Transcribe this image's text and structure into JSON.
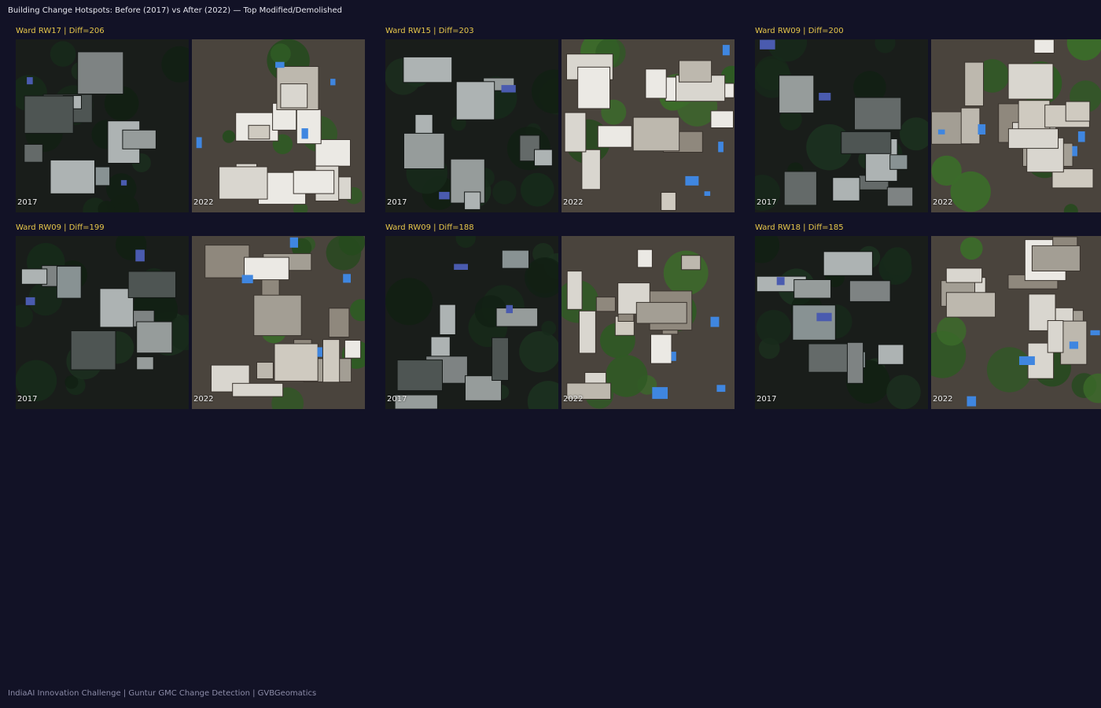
{
  "title": "Building Change Hotspots: Before (2017) vs After (2022) — Top Modified/Demolished",
  "footer": "IndiaAI Innovation Challenge | Guntur GMC Change Detection | GVBGeomatics",
  "before_label": "2017",
  "after_label": "2022",
  "colors": {
    "background": "#121226",
    "title": "#e6e6ee",
    "card_title": "#e7c74a",
    "footer": "#8c8ca8"
  },
  "cards": [
    {
      "title": "Ward RW17 | Diff=206",
      "ward": "RW17",
      "diff": 206
    },
    {
      "title": "Ward RW15 | Diff=203",
      "ward": "RW15",
      "diff": 203
    },
    {
      "title": "Ward RW09 | Diff=200",
      "ward": "RW09",
      "diff": 200
    },
    {
      "title": "Ward RW09 | Diff=199",
      "ward": "RW09",
      "diff": 199
    },
    {
      "title": "Ward RW09 | Diff=188",
      "ward": "RW09",
      "diff": 188
    },
    {
      "title": "Ward RW18 | Diff=185",
      "ward": "RW18",
      "diff": 185
    }
  ]
}
